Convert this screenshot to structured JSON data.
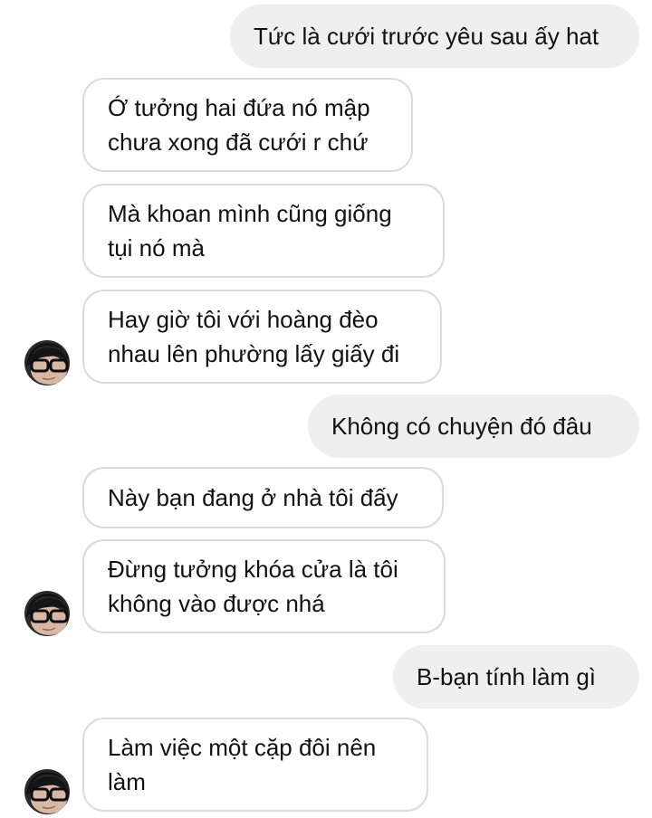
{
  "conversation": {
    "messages": [
      {
        "from": "me",
        "text": "Tức là cưới trước yêu sau ấy hat"
      },
      {
        "from": "them",
        "text": "Ớ tưởng hai đứa nó mập\nchưa xong đã cưới r chứ"
      },
      {
        "from": "them",
        "text": "Mà khoan mình cũng giống\ntụi nó mà"
      },
      {
        "from": "them",
        "text": "Hay giờ tôi với hoàng đèo\nnhau lên phường lấy giấy đi"
      },
      {
        "from": "me",
        "text": "Không có chuyện đó đâu"
      },
      {
        "from": "them",
        "text": "Này bạn đang ở nhà tôi đấy"
      },
      {
        "from": "them",
        "text": "Đừng tưởng khóa cửa là tôi\nkhông vào được nhá"
      },
      {
        "from": "me",
        "text": "B-bạn tính làm gì"
      },
      {
        "from": "them",
        "text": "Làm việc một cặp đôi nên\nlàm"
      }
    ]
  },
  "icons": {
    "avatar": "contact-avatar-icon"
  },
  "colors": {
    "outgoing_bubble": "#efefef",
    "incoming_border": "#dbdbdb",
    "text": "#111111",
    "background": "#ffffff"
  }
}
